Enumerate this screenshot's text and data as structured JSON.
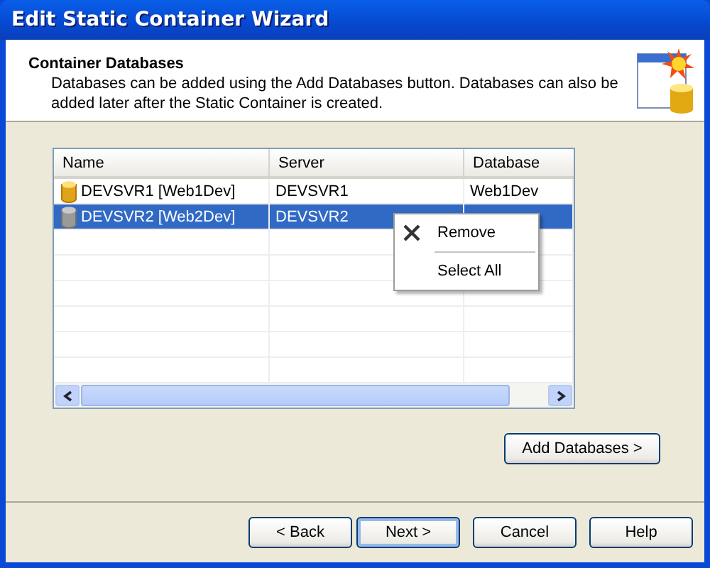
{
  "window": {
    "title": "Edit Static Container Wizard"
  },
  "header": {
    "title": "Container Databases",
    "description": "Databases can be added using the Add Databases button. Databases can also be added later after the Static Container is created."
  },
  "table": {
    "columns": [
      "Name",
      "Server",
      "Database"
    ],
    "rows": [
      {
        "name": "DEVSVR1 [Web1Dev]",
        "server": "DEVSVR1",
        "database": "Web1Dev",
        "selected": false
      },
      {
        "name": "DEVSVR2 [Web2Dev]",
        "server": "DEVSVR2",
        "selected": true
      }
    ]
  },
  "context_menu": {
    "items": [
      {
        "label": "Remove",
        "kind": "icon"
      },
      {
        "label": "Select All",
        "kind": "plain"
      }
    ]
  },
  "add_button": "Add Databases >",
  "buttons": [
    {
      "label": "< Back",
      "default": false
    },
    {
      "label": "Next >",
      "default": true
    },
    {
      "label": "Cancel",
      "default": false
    },
    {
      "label": "Help",
      "default": false
    }
  ]
}
